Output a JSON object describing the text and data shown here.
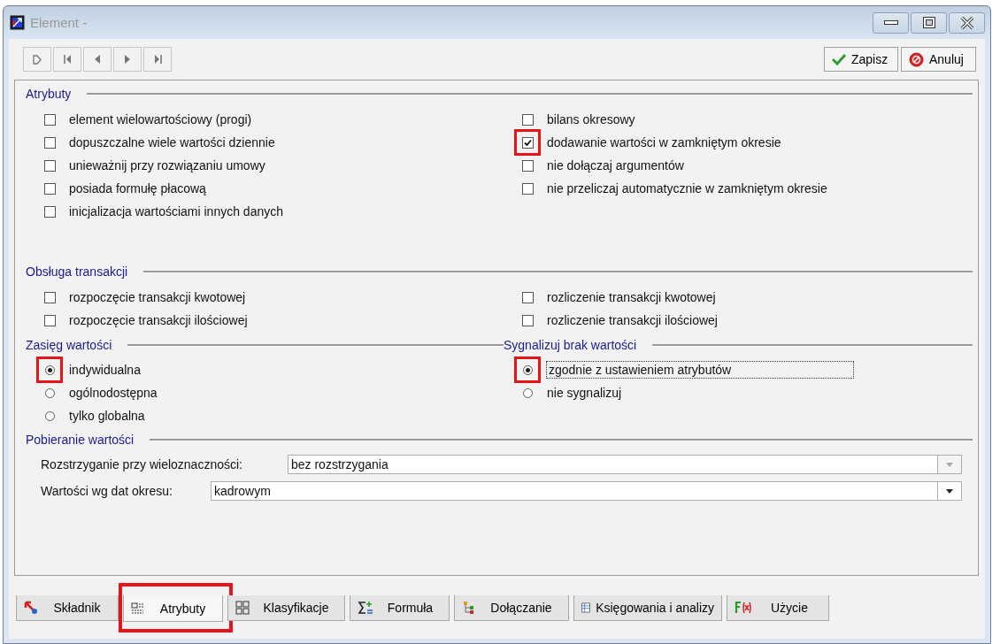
{
  "window": {
    "title": "Element -"
  },
  "actions": [
    {
      "kind": "save",
      "label": "Zapisz"
    },
    {
      "kind": "cancel",
      "label": "Anuluj"
    }
  ],
  "attributes": {
    "title": "Atrybuty",
    "left": [
      {
        "label": "element wielowartościowy (progi)",
        "checked": false,
        "highlighted": false
      },
      {
        "label": "dopuszczalne wiele wartości dziennie",
        "checked": false,
        "highlighted": false
      },
      {
        "label": "unieważnij przy rozwiązaniu umowy",
        "checked": false,
        "highlighted": false
      },
      {
        "label": "posiada formułę płacową",
        "checked": false,
        "highlighted": false
      },
      {
        "label": "inicjalizacja wartościami innych danych",
        "checked": false,
        "highlighted": false
      }
    ],
    "right": [
      {
        "label": "bilans okresowy",
        "checked": false,
        "highlighted": false
      },
      {
        "label": "dodawanie wartości w zamkniętym okresie",
        "checked": true,
        "highlighted": true
      },
      {
        "label": "nie dołączaj argumentów",
        "checked": false,
        "highlighted": false
      },
      {
        "label": "nie przeliczaj automatycznie w zamkniętym okresie",
        "checked": false,
        "highlighted": false
      }
    ]
  },
  "transactions": {
    "title": "Obsługa transakcji",
    "left": [
      {
        "label": "rozpoczęcie transakcji kwotowej",
        "checked": false,
        "highlighted": false
      },
      {
        "label": "rozpoczęcie transakcji ilościowej",
        "checked": false,
        "highlighted": false
      }
    ],
    "right": [
      {
        "label": "rozliczenie transakcji kwotowej",
        "checked": false,
        "highlighted": false
      },
      {
        "label": "rozliczenie transakcji ilościowej",
        "checked": false,
        "highlighted": false
      }
    ]
  },
  "value_scope": {
    "title": "Zasięg wartości",
    "options": [
      {
        "label": "indywidualna",
        "selected": true,
        "highlighted": true,
        "focused": false
      },
      {
        "label": "ogólnodostępna",
        "selected": false,
        "highlighted": false,
        "focused": false
      },
      {
        "label": "tylko globalna",
        "selected": false,
        "highlighted": false,
        "focused": false
      }
    ]
  },
  "missing_value_signal": {
    "title": "Sygnalizuj brak wartości",
    "options": [
      {
        "label": "zgodnie z ustawieniem atrybutów",
        "selected": true,
        "highlighted": true,
        "focused": true
      },
      {
        "label": "nie sygnalizuj",
        "selected": false,
        "highlighted": false,
        "focused": false
      }
    ]
  },
  "value_retrieval": {
    "title": "Pobieranie wartości",
    "fields": [
      {
        "label": "Rozstrzyganie przy wieloznaczności:",
        "value": "bez rozstrzygania",
        "disabled": true
      },
      {
        "label": "Wartości wg dat okresu:",
        "value": "kadrowym",
        "disabled": false
      }
    ]
  },
  "tabs": [
    {
      "kind": "component",
      "label": "Składnik",
      "selected": false,
      "highlighted": false
    },
    {
      "kind": "attributes",
      "label": "Atrybuty",
      "selected": true,
      "highlighted": true
    },
    {
      "kind": "classification",
      "label": "Klasyfikacje",
      "selected": false,
      "highlighted": false
    },
    {
      "kind": "formula",
      "label": "Formuła",
      "selected": false,
      "highlighted": false
    },
    {
      "kind": "attach",
      "label": "Dołączanie",
      "selected": false,
      "highlighted": false
    },
    {
      "kind": "ledger",
      "label": "Księgowania i analizy",
      "selected": false,
      "highlighted": false
    },
    {
      "kind": "usage",
      "label": "Użycie",
      "selected": false,
      "highlighted": false
    }
  ]
}
